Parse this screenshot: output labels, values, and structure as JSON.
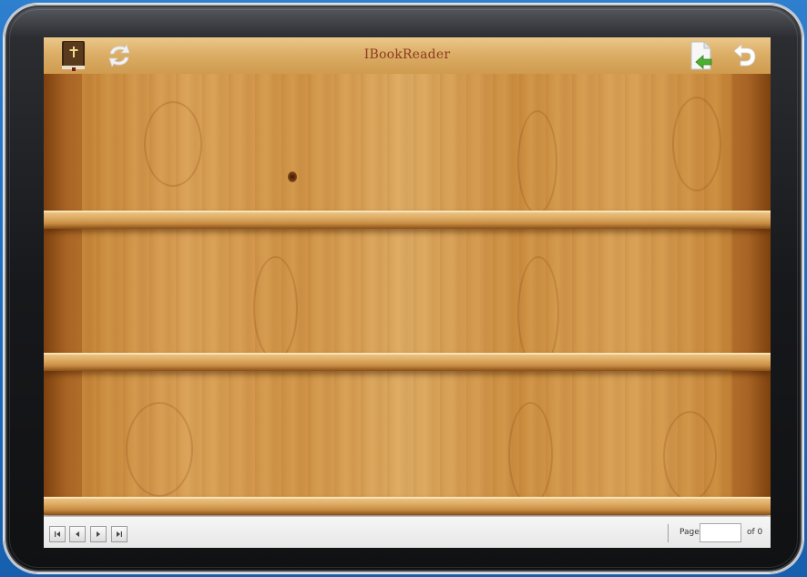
{
  "app": {
    "title": "IBookReader"
  },
  "toolbar": {
    "left_icons": [
      "bible-book-icon",
      "refresh-icon"
    ],
    "right_icons": [
      "page-back-icon",
      "return-icon"
    ]
  },
  "bookshelf": {
    "shelf_count": 3,
    "books": []
  },
  "pager": {
    "buttons": [
      "first-page-icon",
      "previous-page-icon",
      "next-page-icon",
      "last-page-icon"
    ],
    "page_label": "Page",
    "page_value": "",
    "of_label": "of 0"
  },
  "colors": {
    "title_text": "#8b3a22",
    "wood_light": "#ddaa62",
    "wood_dark": "#8a4f18",
    "desktop_blue": "#1e6ec0"
  }
}
